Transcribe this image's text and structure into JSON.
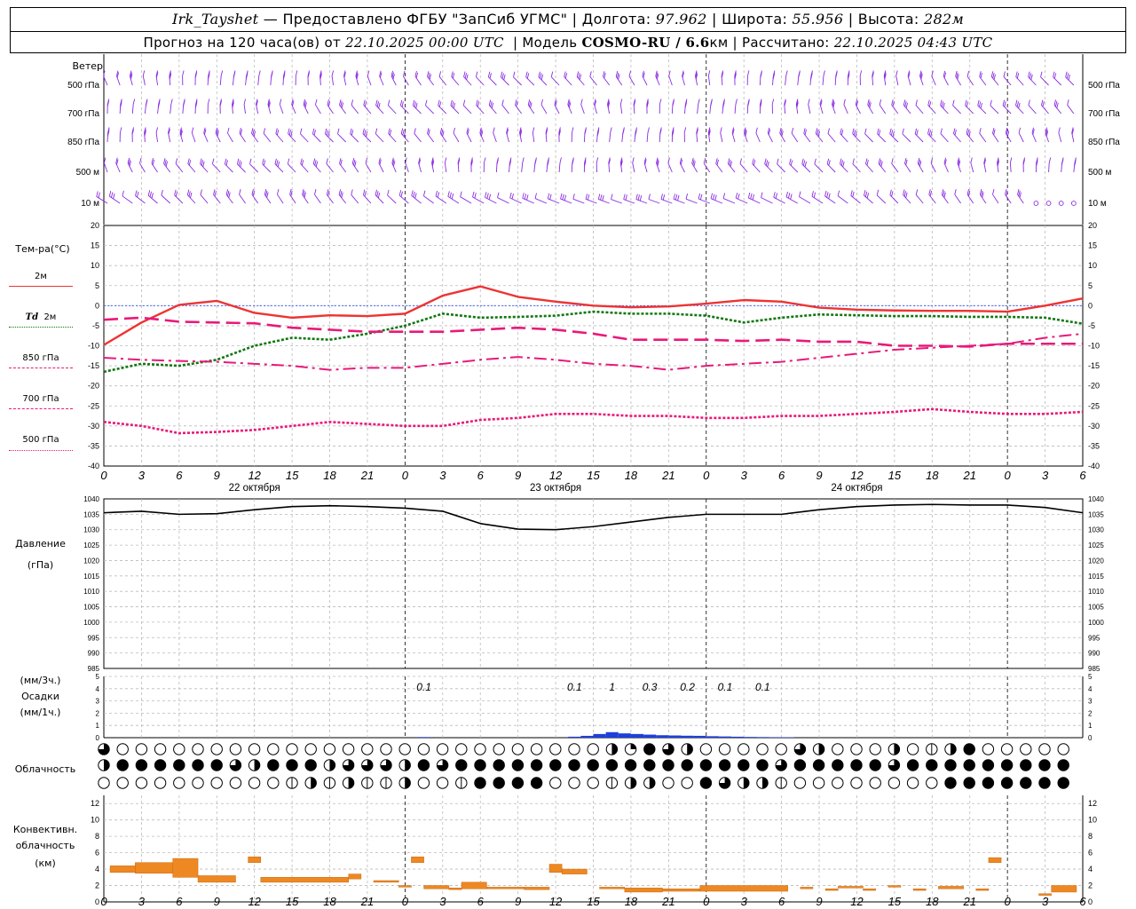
{
  "header": {
    "station": "Irk_Tayshet",
    "provider": "— Предоставлено ФГБУ \"ЗапСиб УГМС\"",
    "lon_label": "Долгота:",
    "lon": "97.962",
    "lat_label": "Широта:",
    "lat": "55.956",
    "alt_label": "Высота:",
    "alt": "282м",
    "forecast_label": "Прогноз на 120 часа(ов) от",
    "forecast_start": "22.10.2025 00:00 UTC",
    "model_label": "Модель",
    "model": "COSMO-RU / 6.6",
    "model_unit": "км",
    "calc_label": "Рассчитано:",
    "calc_time": "22.10.2025 04:43 UTC"
  },
  "wind": {
    "title": "Ветер",
    "levels": [
      "500 гПа",
      "700 гПа",
      "850 гПа",
      "500 м",
      "10 м"
    ],
    "color": "#8a2be2"
  },
  "temperature": {
    "title": "Тем-ра(°C)",
    "legend": [
      {
        "label": "2м",
        "color": "#ee3333",
        "dash": "solid"
      },
      {
        "label": "Td",
        "label2": "2м",
        "color": "#117711",
        "dash": "dotted"
      },
      {
        "label": "850 гПа",
        "color": "#e8197a",
        "dash": "dash"
      },
      {
        "label": "700 гПа",
        "color": "#e8197a",
        "dash": "dashdot"
      },
      {
        "label": "500 гПа",
        "color": "#e8197a",
        "dash": "dotted"
      }
    ]
  },
  "pressure": {
    "title": "Давление",
    "unit": "(гПа)"
  },
  "precip": {
    "title1": "(мм/3ч.)",
    "title2": "Осадки",
    "title3": "(мм/1ч.)",
    "color": "#1f3fd9"
  },
  "cloud": {
    "title": "Облачность"
  },
  "convective": {
    "title1": "Конвективн.",
    "title2": "облачность",
    "title3": "(км)",
    "color": "#ee8822"
  },
  "dates": [
    "22 октября",
    "23 октября",
    "24 октября"
  ],
  "chart_data": [
    {
      "type": "line",
      "title": "Тем-ра(°C)",
      "x_hours": [
        0,
        3,
        6,
        9,
        12,
        15,
        18,
        21,
        24,
        27,
        30,
        33,
        36,
        39,
        42,
        45,
        48,
        51,
        54,
        57,
        60,
        63,
        66,
        69,
        72,
        75,
        78
      ],
      "x_tick_labels": [
        "0",
        "3",
        "6",
        "9",
        "12",
        "15",
        "18",
        "21",
        "0",
        "3",
        "6",
        "9",
        "12",
        "15",
        "18",
        "21",
        "0",
        "3",
        "6",
        "9",
        "12",
        "15",
        "18",
        "21",
        "0",
        "3",
        "6"
      ],
      "ylim": [
        -40,
        20
      ],
      "yticks": [
        20,
        15,
        10,
        5,
        0,
        -5,
        -10,
        -15,
        -20,
        -25,
        -30,
        -35,
        -40
      ],
      "series": [
        {
          "name": "2м",
          "values": [
            -9.8,
            -4.2,
            0.2,
            1.2,
            -1.8,
            -3.0,
            -2.4,
            -2.6,
            -2.0,
            2.5,
            4.8,
            2.2,
            1.0,
            0.0,
            -0.4,
            -0.2,
            0.5,
            1.4,
            1.0,
            -0.5,
            -1.0,
            -1.2,
            -1.3,
            -1.3,
            -1.5,
            0.0,
            1.8
          ]
        },
        {
          "name": "Td 2м",
          "values": [
            -16.5,
            -14.5,
            -15.0,
            -13.5,
            -10.0,
            -8.0,
            -8.5,
            -7.0,
            -5.0,
            -2.0,
            -3.0,
            -2.8,
            -2.5,
            -1.5,
            -2.0,
            -2.0,
            -2.5,
            -4.2,
            -3.0,
            -2.2,
            -2.4,
            -2.6,
            -2.6,
            -2.8,
            -2.8,
            -3.0,
            -4.5
          ]
        },
        {
          "name": "850 гПа",
          "values": [
            -3.5,
            -3.0,
            -4.0,
            -4.2,
            -4.4,
            -5.5,
            -6.0,
            -6.5,
            -6.5,
            -6.5,
            -6.0,
            -5.5,
            -6.0,
            -7.0,
            -8.5,
            -8.5,
            -8.5,
            -8.8,
            -8.5,
            -9.0,
            -9.0,
            -10.0,
            -10.0,
            -10.2,
            -9.5,
            -9.5,
            -9.5
          ]
        },
        {
          "name": "700 гПа",
          "values": [
            -13.0,
            -13.5,
            -13.8,
            -14.0,
            -14.5,
            -15.0,
            -16.0,
            -15.5,
            -15.5,
            -14.5,
            -13.5,
            -12.8,
            -13.5,
            -14.5,
            -15.0,
            -16.0,
            -15.0,
            -14.5,
            -14.0,
            -13.0,
            -12.0,
            -11.0,
            -10.5,
            -10.0,
            -9.5,
            -8.0,
            -7.0
          ]
        },
        {
          "name": "500 гПа",
          "values": [
            -29.0,
            -30.0,
            -31.8,
            -31.5,
            -31.0,
            -30.0,
            -29.0,
            -29.5,
            -30.0,
            -30.0,
            -28.5,
            -28.0,
            -27.0,
            -27.0,
            -27.5,
            -27.5,
            -28.0,
            -28.0,
            -27.5,
            -27.5,
            -27.0,
            -26.5,
            -25.8,
            -26.5,
            -27.0,
            -27.0,
            -26.5
          ]
        }
      ]
    },
    {
      "type": "line",
      "title": "Давление",
      "ylabel": "(гПа)",
      "ylim": [
        985,
        1040
      ],
      "yticks": [
        1040,
        1035,
        1030,
        1025,
        1020,
        1015,
        1010,
        1005,
        1000,
        995,
        990,
        985
      ],
      "series": [
        {
          "name": "",
          "values": [
            1035.5,
            1036.0,
            1035.0,
            1035.2,
            1036.5,
            1037.5,
            1037.8,
            1037.5,
            1037.0,
            1036.0,
            1032.0,
            1030.2,
            1030.0,
            1031.0,
            1032.5,
            1034.0,
            1035.0,
            1035.0,
            1035.0,
            1036.5,
            1037.5,
            1038.0,
            1038.2,
            1038.0,
            1038.0,
            1037.2,
            1035.5
          ]
        }
      ]
    },
    {
      "type": "bar",
      "title": "Осадки",
      "ylabel": "(мм/1ч.)",
      "ylim": [
        0,
        5
      ],
      "yticks": [
        5,
        4,
        3,
        2,
        1,
        0
      ],
      "annotations": [
        {
          "hour": 25.5,
          "text": "0.1"
        },
        {
          "hour": 37.5,
          "text": "0.1"
        },
        {
          "hour": 40.5,
          "text": "1"
        },
        {
          "hour": 43.5,
          "text": "0.3"
        },
        {
          "hour": 46.5,
          "text": "0.2"
        },
        {
          "hour": 49.5,
          "text": "0.1"
        },
        {
          "hour": 52.5,
          "text": "0.1"
        }
      ],
      "bars": [
        {
          "hour": 25,
          "value": 0.05
        },
        {
          "hour": 37,
          "value": 0.08
        },
        {
          "hour": 38,
          "value": 0.15
        },
        {
          "hour": 39,
          "value": 0.3
        },
        {
          "hour": 40,
          "value": 0.45
        },
        {
          "hour": 41,
          "value": 0.35
        },
        {
          "hour": 42,
          "value": 0.3
        },
        {
          "hour": 43,
          "value": 0.25
        },
        {
          "hour": 44,
          "value": 0.2
        },
        {
          "hour": 45,
          "value": 0.18
        },
        {
          "hour": 46,
          "value": 0.16
        },
        {
          "hour": 47,
          "value": 0.15
        },
        {
          "hour": 48,
          "value": 0.12
        },
        {
          "hour": 49,
          "value": 0.1
        },
        {
          "hour": 50,
          "value": 0.08
        },
        {
          "hour": 51,
          "value": 0.06
        },
        {
          "hour": 52,
          "value": 0.05
        },
        {
          "hour": 53,
          "value": 0.04
        },
        {
          "hour": 54,
          "value": 0.03
        }
      ]
    },
    {
      "type": "table",
      "title": "Облачность",
      "rows": [
        "3000000000000000000000000002543200000320002012400000001323044440000000000000000000000000000000000000000000000000000000000000000000000000000000000000",
        "2444444324442333243444444444444444443444443444444444444444444444444444444444444444444444444444444444444444444444444444444444444444444444444444",
        "0000000000121211200144440001220043221000000004444444444444444444444444444444444222444444444444444444444444444444444444444444444444444444444444"
      ]
    },
    {
      "type": "bar",
      "title": "Конвективн. облачность",
      "ylabel": "(км)",
      "ylim": [
        0,
        13
      ],
      "yticks": [
        12,
        10,
        8,
        6,
        4,
        2,
        0
      ],
      "segments": [
        {
          "from": 0.5,
          "to": 2.5,
          "low": 3.6,
          "high": 4.4
        },
        {
          "from": 2.5,
          "to": 5.5,
          "low": 3.5,
          "high": 4.8
        },
        {
          "from": 5.5,
          "to": 7.5,
          "low": 3.0,
          "high": 5.3
        },
        {
          "from": 7.5,
          "to": 10.5,
          "low": 2.4,
          "high": 3.2
        },
        {
          "from": 11.5,
          "to": 12.5,
          "low": 4.8,
          "high": 5.5
        },
        {
          "from": 12.5,
          "to": 19.5,
          "low": 2.4,
          "high": 3.0
        },
        {
          "from": 19.5,
          "to": 20.5,
          "low": 2.8,
          "high": 3.4
        },
        {
          "from": 21.5,
          "to": 23.5,
          "low": 2.4,
          "high": 2.6
        },
        {
          "from": 23.5,
          "to": 24.5,
          "low": 1.8,
          "high": 2.0
        },
        {
          "from": 24.5,
          "to": 25.5,
          "low": 4.8,
          "high": 5.5
        },
        {
          "from": 25.5,
          "to": 27.5,
          "low": 1.6,
          "high": 2.0
        },
        {
          "from": 27.5,
          "to": 28.5,
          "low": 1.5,
          "high": 1.7
        },
        {
          "from": 28.5,
          "to": 30.5,
          "low": 1.6,
          "high": 2.4
        },
        {
          "from": 30.5,
          "to": 33.5,
          "low": 1.6,
          "high": 1.8
        },
        {
          "from": 33.5,
          "to": 35.5,
          "low": 1.5,
          "high": 1.8
        },
        {
          "from": 35.5,
          "to": 36.5,
          "low": 3.6,
          "high": 4.6
        },
        {
          "from": 36.5,
          "to": 38.5,
          "low": 3.4,
          "high": 4.0
        },
        {
          "from": 39.5,
          "to": 41.5,
          "low": 1.6,
          "high": 1.8
        },
        {
          "from": 41.5,
          "to": 44.5,
          "low": 1.2,
          "high": 1.7
        },
        {
          "from": 44.5,
          "to": 47.5,
          "low": 1.3,
          "high": 1.6
        },
        {
          "from": 47.5,
          "to": 54.5,
          "low": 1.3,
          "high": 2.0
        },
        {
          "from": 55.5,
          "to": 56.5,
          "low": 1.6,
          "high": 1.8
        },
        {
          "from": 57.5,
          "to": 58.5,
          "low": 1.4,
          "high": 1.6
        },
        {
          "from": 58.5,
          "to": 60.5,
          "low": 1.7,
          "high": 1.9
        },
        {
          "from": 60.5,
          "to": 61.5,
          "low": 1.4,
          "high": 1.6
        },
        {
          "from": 62.5,
          "to": 63.5,
          "low": 1.8,
          "high": 2.0
        },
        {
          "from": 64.5,
          "to": 65.5,
          "low": 1.4,
          "high": 1.6
        },
        {
          "from": 66.5,
          "to": 68.5,
          "low": 1.6,
          "high": 1.9
        },
        {
          "from": 69.5,
          "to": 70.5,
          "low": 1.4,
          "high": 1.6
        },
        {
          "from": 70.5,
          "to": 71.5,
          "low": 4.8,
          "high": 5.4
        },
        {
          "from": 74.5,
          "to": 75.5,
          "low": 0.8,
          "high": 1.0
        },
        {
          "from": 75.5,
          "to": 77.5,
          "low": 1.2,
          "high": 2.0
        }
      ]
    }
  ]
}
